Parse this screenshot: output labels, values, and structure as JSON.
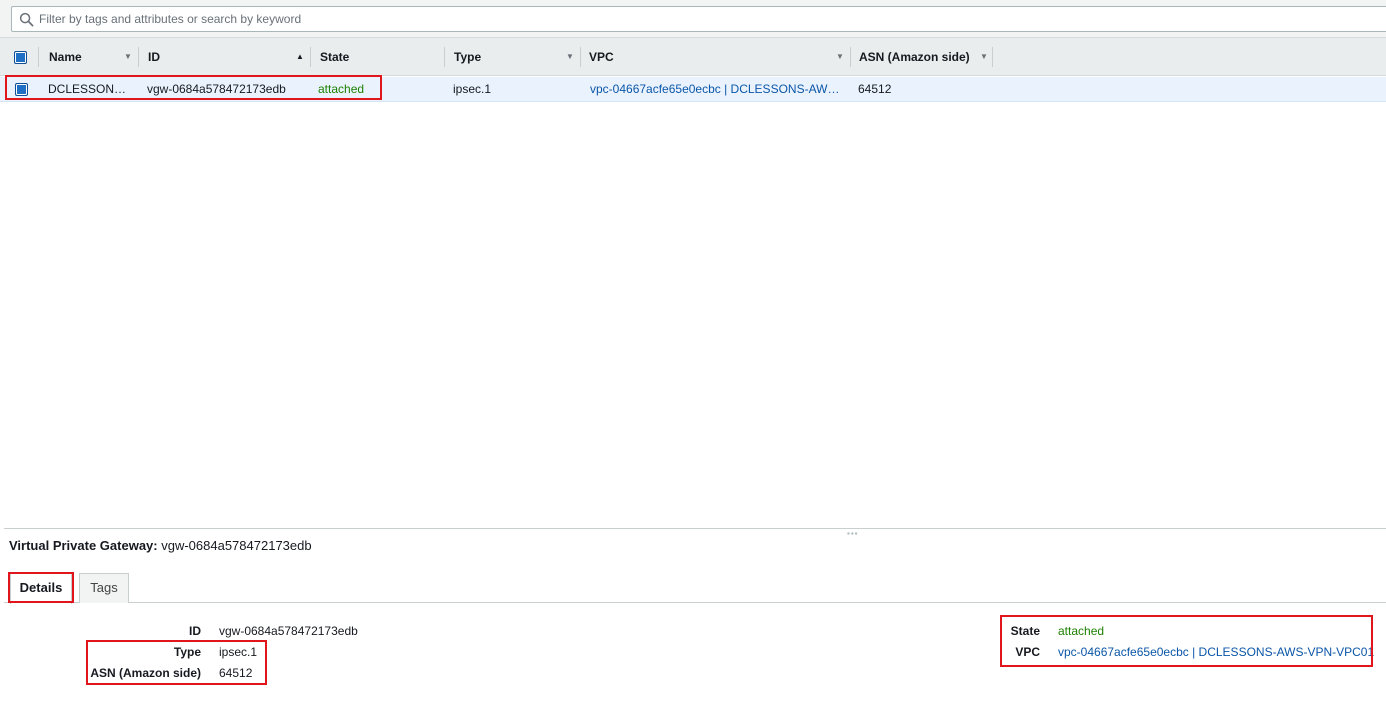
{
  "filter": {
    "placeholder": "Filter by tags and attributes or search by keyword",
    "icon": "search-icon"
  },
  "table": {
    "columns": [
      {
        "label": "Name",
        "sort": "none"
      },
      {
        "label": "ID",
        "sort": "ascending"
      },
      {
        "label": "State",
        "sort": "none"
      },
      {
        "label": "Type",
        "sort": "none"
      },
      {
        "label": "VPC",
        "sort": "none"
      },
      {
        "label": "ASN (Amazon side)",
        "sort": "none"
      }
    ],
    "rows": [
      {
        "selected": true,
        "name": "DCLESSON…",
        "id": "vgw-0684a578472173edb",
        "state": "attached",
        "type": "ipsec.1",
        "vpc": "vpc-04667acfe65e0ecbc | DCLESSONS-AW…",
        "asn": "64512"
      }
    ]
  },
  "details_panel": {
    "title_label": "Virtual Private Gateway:",
    "title_value": "vgw-0684a578472173edb",
    "tabs": [
      {
        "label": "Details",
        "active": true
      },
      {
        "label": "Tags",
        "active": false
      }
    ],
    "left_fields": [
      {
        "label": "ID",
        "value": "vgw-0684a578472173edb"
      },
      {
        "label": "Type",
        "value": "ipsec.1"
      },
      {
        "label": "ASN (Amazon side)",
        "value": "64512"
      }
    ],
    "right_fields": [
      {
        "label": "State",
        "value": "attached"
      },
      {
        "label": "VPC",
        "value": "vpc-04667acfe65e0ecbc | DCLESSONS-AWS-VPN-VPC01"
      }
    ]
  },
  "colors": {
    "highlight_box": "#e0161c",
    "state_attached": "#1d8102",
    "link": "#0b56a8",
    "selected_row": "#eaf3fd"
  }
}
